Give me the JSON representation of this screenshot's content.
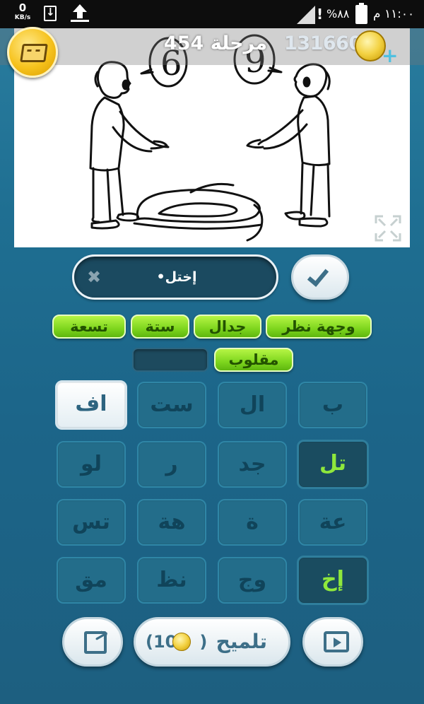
{
  "status_bar": {
    "data_rate": "0",
    "data_unit": "KB/s",
    "battery": "%٨٨",
    "time": "١١:٠٠ م"
  },
  "header": {
    "level_title": "مرحلة 454",
    "coins": "1316607",
    "plus": "+"
  },
  "answer": {
    "text": "إختل•",
    "clear_symbol": "✖"
  },
  "hint_words": {
    "row1": [
      "وجهة نظر",
      "جدال",
      "ستة",
      "تسعة"
    ],
    "row2": [
      "مقلوب"
    ]
  },
  "tiles": [
    [
      "ب",
      "ال",
      "ست",
      "اف"
    ],
    [
      "تل",
      "جد",
      "ر",
      "لو"
    ],
    [
      "عة",
      "ة",
      "هة",
      "تس"
    ],
    [
      "إخ",
      "وج",
      "نظ",
      "مق"
    ]
  ],
  "bottom": {
    "hint_label": "تلميح",
    "hint_cost_open": "(10",
    "hint_cost_close": ")"
  },
  "colors": {
    "accent_green": "#8fe83c",
    "panel_blue": "#1f6f92"
  }
}
